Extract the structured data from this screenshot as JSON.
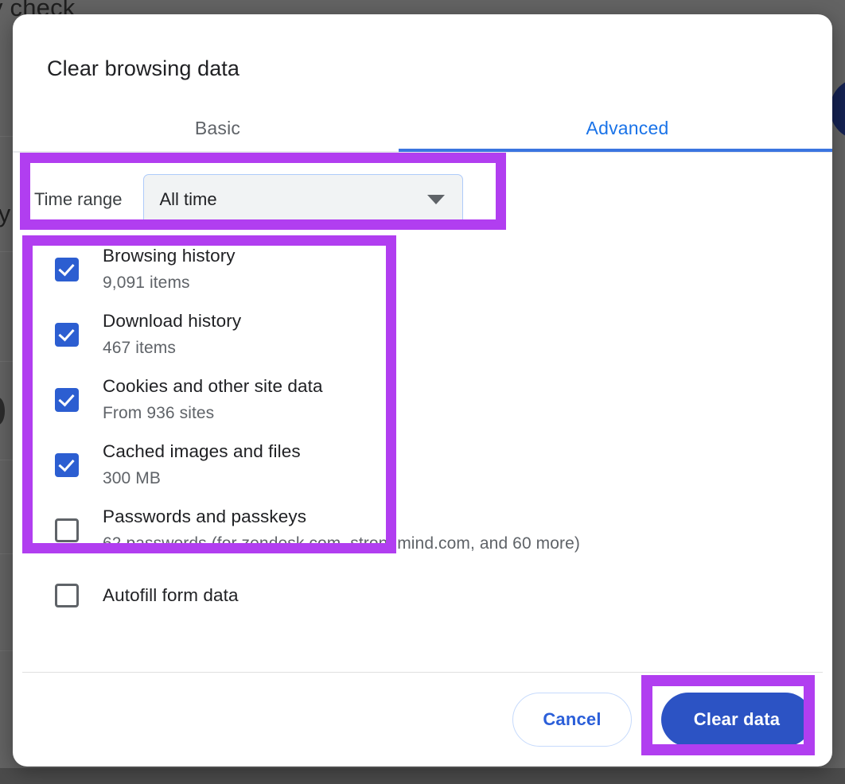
{
  "background": {
    "text_fragments": [
      "y check",
      "cy"
    ],
    "scrim_color": "#616161"
  },
  "dialog": {
    "title": "Clear browsing data",
    "tabs": [
      {
        "label": "Basic",
        "active": false
      },
      {
        "label": "Advanced",
        "active": true
      }
    ],
    "time_range": {
      "label": "Time range",
      "value": "All time",
      "dropdown_icon": "chevron-down-icon"
    },
    "data_types": [
      {
        "title": "Browsing history",
        "subtitle": "9,091 items",
        "checked": true
      },
      {
        "title": "Download history",
        "subtitle": "467 items",
        "checked": true
      },
      {
        "title": "Cookies and other site data",
        "subtitle": "From 936 sites",
        "checked": true
      },
      {
        "title": "Cached images and files",
        "subtitle": "300 MB",
        "checked": true
      },
      {
        "title": "Passwords and passkeys",
        "subtitle": "62 passwords (for zendesk.com, strongmind.com, and 60 more)",
        "checked": false
      },
      {
        "title": "Autofill form data",
        "subtitle": "",
        "checked": false
      }
    ],
    "footer": {
      "cancel_label": "Cancel",
      "primary_label": "Clear data"
    }
  },
  "annotations": {
    "highlight_color": "#b13ef0",
    "regions": [
      "time-range-row",
      "checked-data-types",
      "clear-data-button"
    ]
  },
  "colors": {
    "accent_blue": "#1a73e8",
    "primary_button": "#2c53c4",
    "checkbox_blue": "#2c5ed1",
    "select_fill": "#f1f3f4",
    "select_border": "#aecbfa",
    "highlight_purple": "#b13ef0"
  }
}
